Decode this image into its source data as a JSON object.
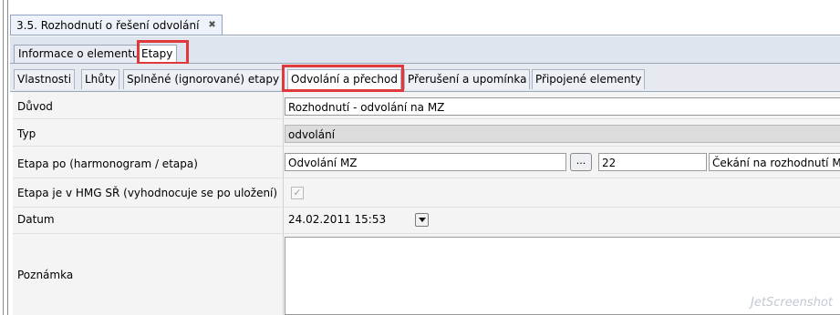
{
  "document_tab": {
    "title": "3.5. Rozhodnutí o řešení odvolání",
    "close_glyph": "✖"
  },
  "tabs_primary": [
    {
      "label": "Informace o elementu"
    },
    {
      "label": "Etapy"
    }
  ],
  "tabs_secondary": [
    {
      "label": "Vlastnosti"
    },
    {
      "label": "Lhůty"
    },
    {
      "label": "Splněné (ignorované) etapy"
    },
    {
      "label": "Odvolání a přechod"
    },
    {
      "label": "Přerušení a upomínka"
    },
    {
      "label": "Připojené elementy"
    }
  ],
  "form": {
    "duvod": {
      "label": "Důvod",
      "value": "Rozhodnutí - odvolání na MZ"
    },
    "typ": {
      "label": "Typ",
      "value": "odvolání"
    },
    "etapa_po": {
      "label": "Etapa po (harmonogram / etapa)",
      "harmonogram": "Odvolání MZ",
      "browse": "...",
      "number": "22",
      "etapa": "Čekání na rozhodnutí MZ"
    },
    "etapa_hmg": {
      "label": "Etapa je v HMG SŘ (vyhodnocuje se po uložení)",
      "checked": true,
      "check_glyph": "✓"
    },
    "datum": {
      "label": "Datum",
      "value": "24.02.2011 15:53"
    },
    "poznamka": {
      "label": "Poznámka",
      "value": ""
    }
  },
  "watermark": "JetScreenshot",
  "colors": {
    "highlight": "#e0393b"
  }
}
